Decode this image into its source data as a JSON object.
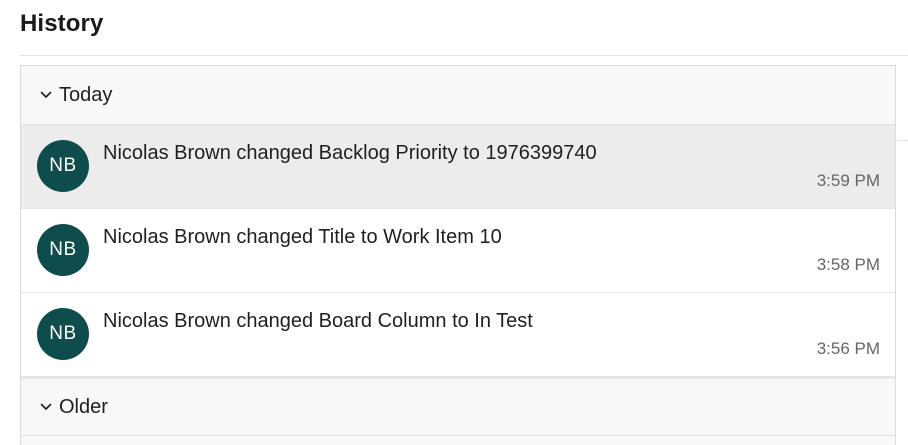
{
  "history": {
    "title": "History",
    "groups": [
      {
        "label": "Today",
        "expanded": true,
        "items": [
          {
            "avatar_initials": "NB",
            "message": "Nicolas Brown changed Backlog Priority to 1976399740",
            "time": "3:59 PM",
            "selected": true
          },
          {
            "avatar_initials": "NB",
            "message": "Nicolas Brown changed Title to Work Item 10",
            "time": "3:58 PM",
            "selected": false
          },
          {
            "avatar_initials": "NB",
            "message": "Nicolas Brown changed Board Column to In Test",
            "time": "3:56 PM",
            "selected": false
          }
        ]
      },
      {
        "label": "Older",
        "expanded": true,
        "items": []
      }
    ]
  },
  "icons": {
    "group_toggle": "chevron-down-icon"
  },
  "colors": {
    "avatar_background": "#0f4d4c",
    "selected_row_background": "#ececec",
    "group_header_background": "#f8f8f8"
  }
}
